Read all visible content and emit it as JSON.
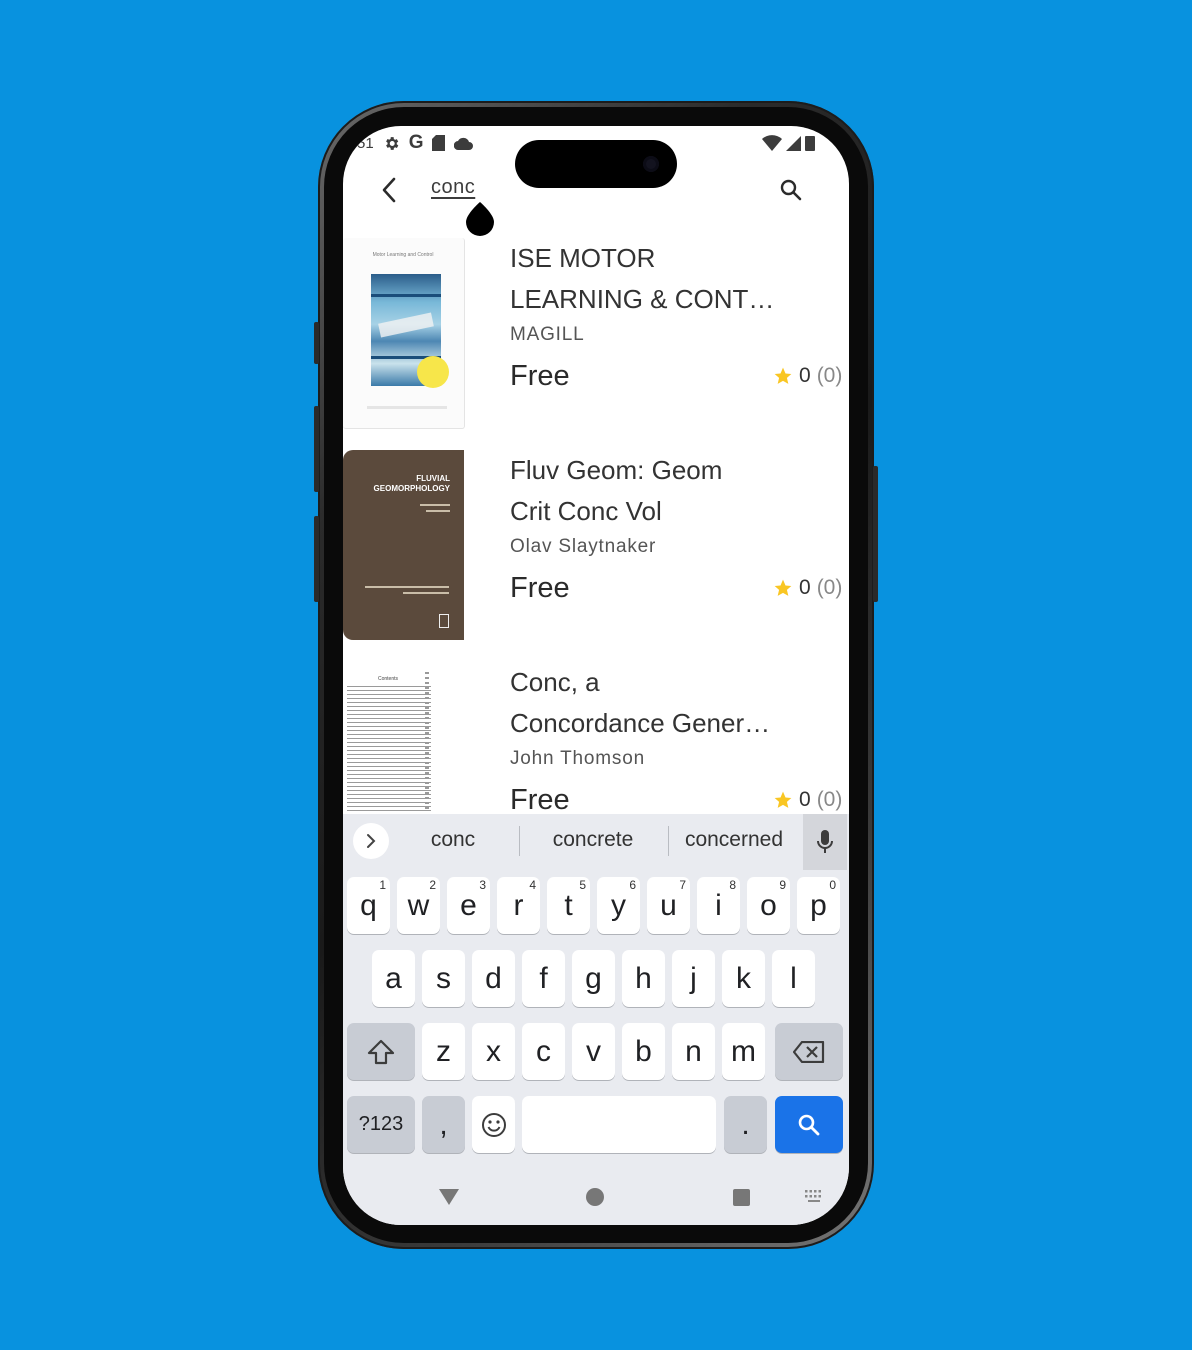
{
  "status": {
    "time_partial": "51",
    "icons": [
      "gear-icon",
      "google-icon",
      "sd-card-icon",
      "cloud-icon"
    ],
    "right_icons": [
      "wifi-icon",
      "signal-icon",
      "battery-icon"
    ]
  },
  "topbar": {
    "back_icon": "chevron-left-icon",
    "search_query": "conc",
    "search_icon": "search-icon"
  },
  "results": [
    {
      "title_line1": "ISE MOTOR",
      "title_line2": "LEARNING & CONTROL",
      "author": "MAGILL",
      "price": "Free",
      "rating": "0",
      "rating_count": "(0)",
      "cover_text": "Motor Learning and Control"
    },
    {
      "title_line1": "Fluv Geom: Geom",
      "title_line2": "Crit Conc Vol",
      "author": "Olav Slaytnaker",
      "price": "Free",
      "rating": "0",
      "rating_count": "(0)",
      "cover_text": "FLUVIAL GEOMORPHOLOGY"
    },
    {
      "title_line1": "Conc, a",
      "title_line2": "Concordance Generator",
      "author": "John Thomson",
      "price": "Free",
      "rating": "0",
      "rating_count": "(0)",
      "cover_text": "Contents"
    }
  ],
  "keyboard": {
    "suggestions": [
      "conc",
      "concrete",
      "concerned"
    ],
    "row1": [
      "q",
      "w",
      "e",
      "r",
      "t",
      "y",
      "u",
      "i",
      "o",
      "p"
    ],
    "row1_hints": [
      "1",
      "2",
      "3",
      "4",
      "5",
      "6",
      "7",
      "8",
      "9",
      "0"
    ],
    "row2": [
      "a",
      "s",
      "d",
      "f",
      "g",
      "h",
      "j",
      "k",
      "l"
    ],
    "row3": [
      "z",
      "x",
      "c",
      "v",
      "b",
      "n",
      "m"
    ],
    "symbols_key": "?123",
    "comma_key": ",",
    "period_key": "."
  },
  "colors": {
    "background": "#0892df",
    "accent_blue": "#1a73e8",
    "star": "#f9c623"
  }
}
